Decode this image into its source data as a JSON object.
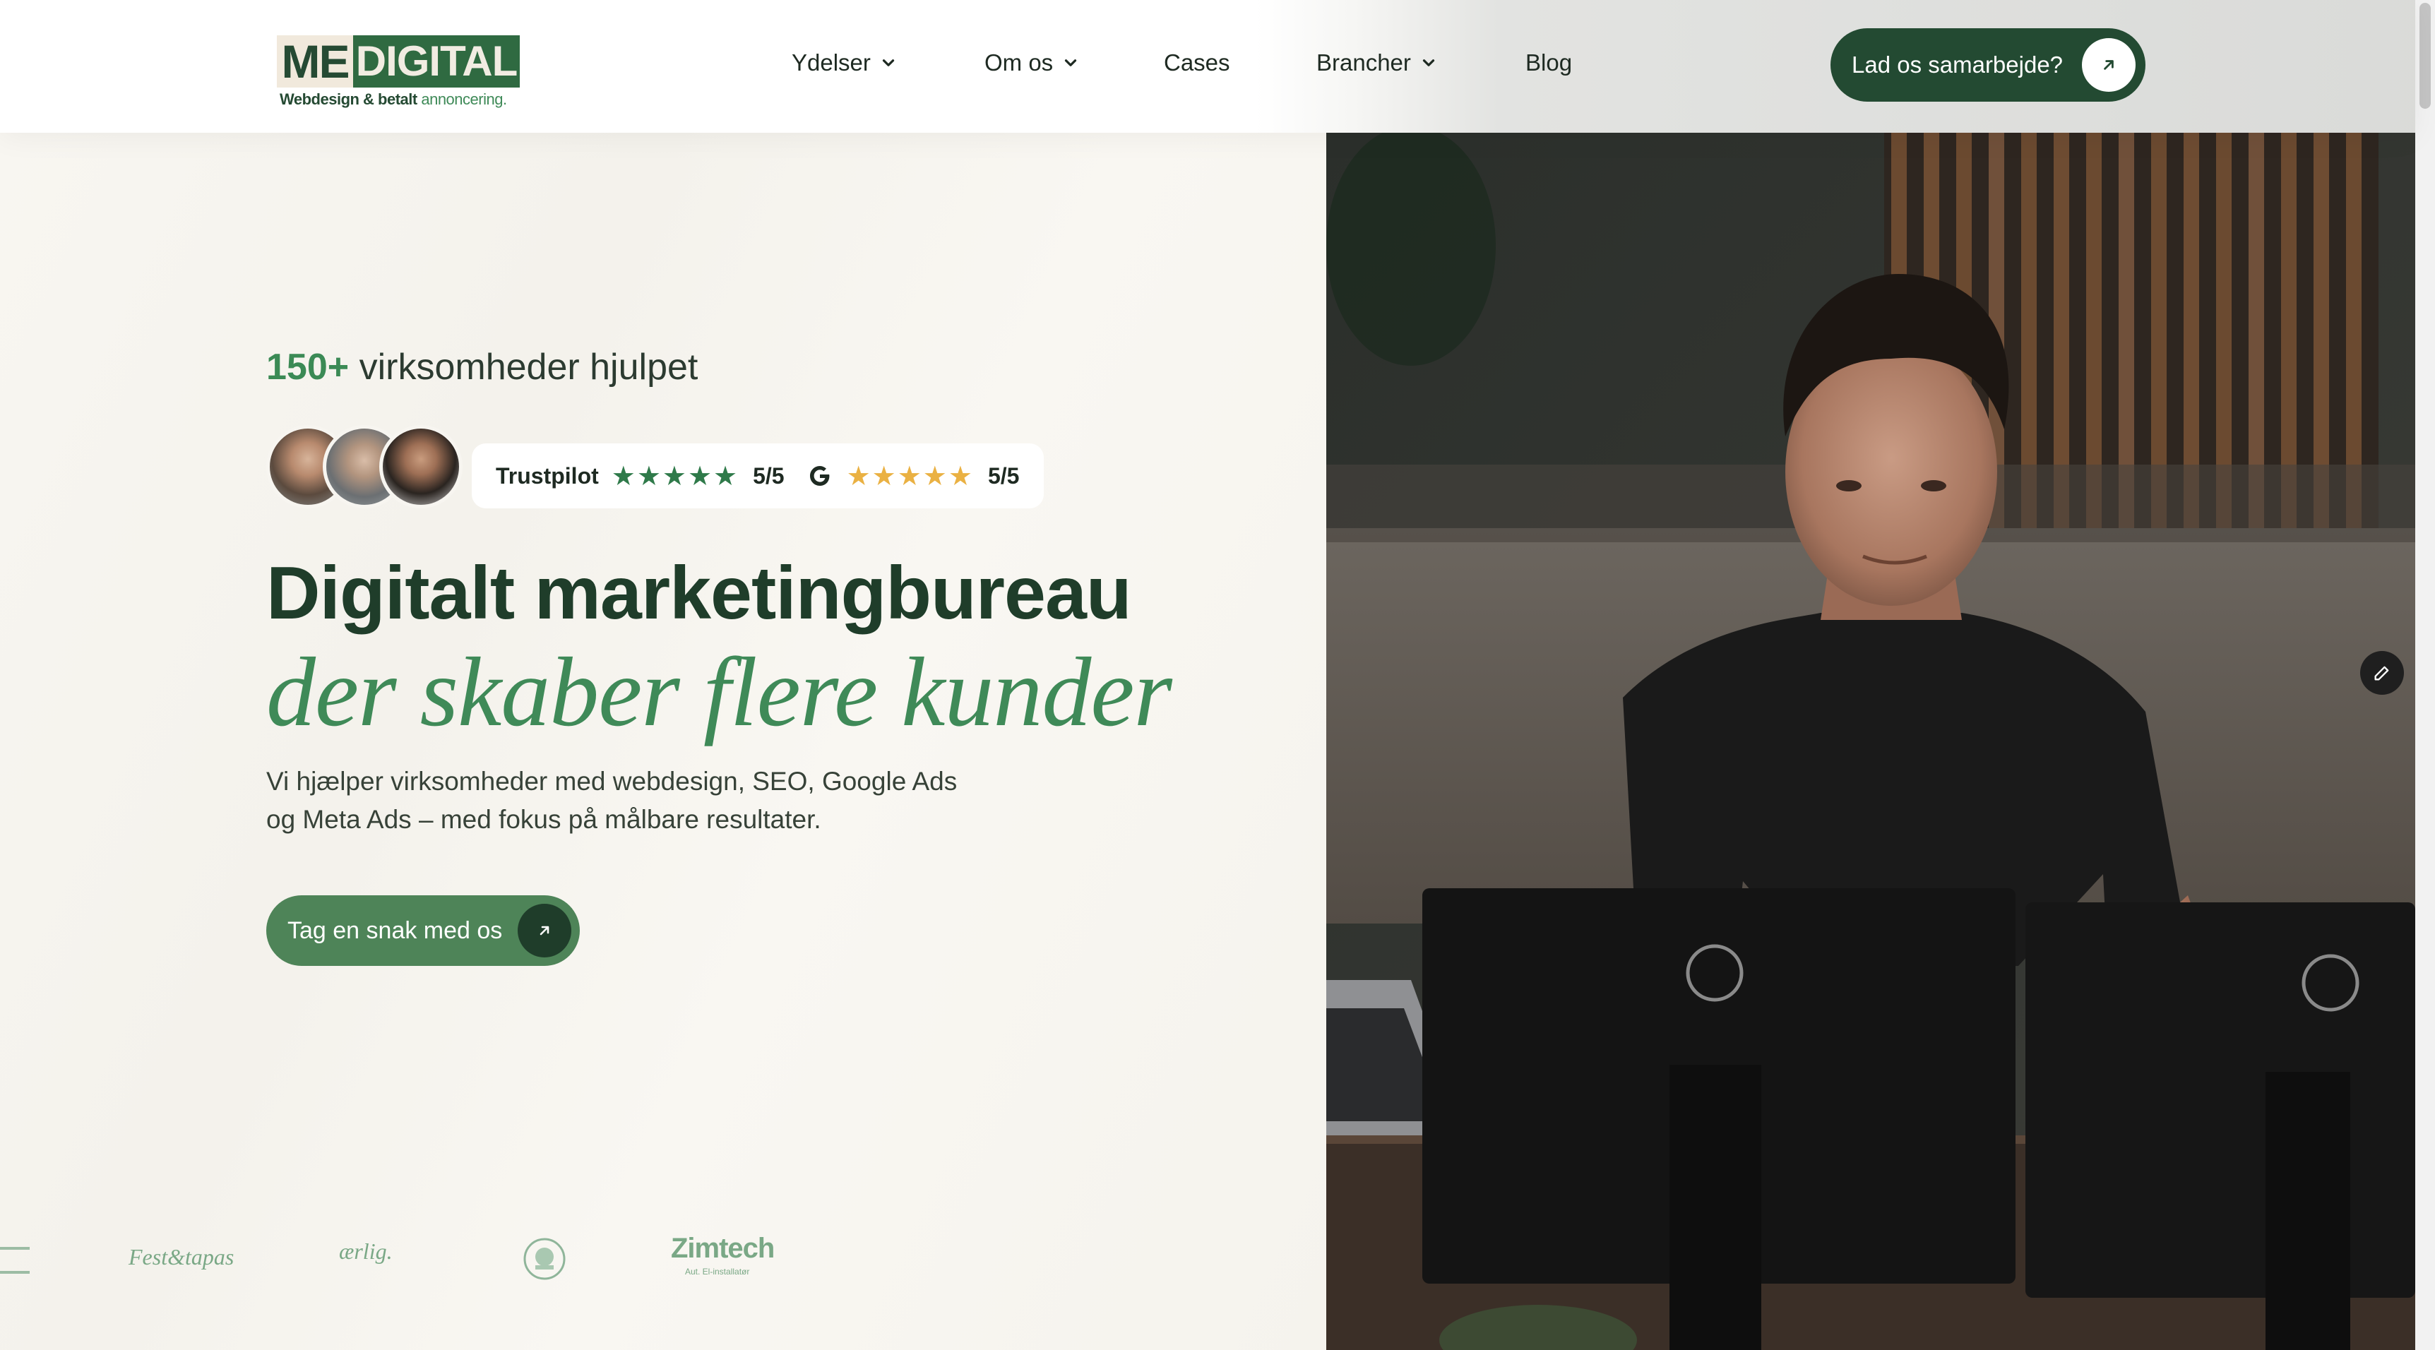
{
  "header": {
    "logo": {
      "me": "ME",
      "digital": "DIGITAL",
      "tagline_a": "Webdesign & betalt ",
      "tagline_b": "annoncering."
    },
    "nav": [
      {
        "label": "Ydelser",
        "has_dropdown": true
      },
      {
        "label": "Om os",
        "has_dropdown": true
      },
      {
        "label": "Cases",
        "has_dropdown": false
      },
      {
        "label": "Brancher",
        "has_dropdown": true
      },
      {
        "label": "Blog",
        "has_dropdown": false
      }
    ],
    "cta": {
      "label": "Lad os samarbejde?",
      "icon": "arrow-up-right-icon"
    }
  },
  "hero": {
    "stat_number": "150+",
    "stat_text": " virksomheder hjulpet",
    "ratings": {
      "trustpilot_label": "Trustpilot",
      "trustpilot_stars": "★★★★★",
      "trustpilot_score": "5/5",
      "google_stars": "★★★★★",
      "google_score": "5/5"
    },
    "headline": "Digitalt marketingbureau",
    "headline_italic": "der skaber flere kunder",
    "lead": "Vi hjælper virksomheder med webdesign, SEO, Google Ads og Meta Ads – med fokus på målbare resultater.",
    "cta": {
      "label": "Tag en snak med os",
      "icon": "arrow-up-right-icon"
    }
  },
  "client_logos": [
    "Fest&tapas",
    "ærlig.",
    "Zimtech",
    "Aut. El-installatør"
  ],
  "colors": {
    "brand_dark": "#234a32",
    "brand_green": "#3f8a58",
    "cta_green": "#4e8458",
    "trustpilot_star": "#2f7a4a",
    "google_star": "#eab143"
  }
}
